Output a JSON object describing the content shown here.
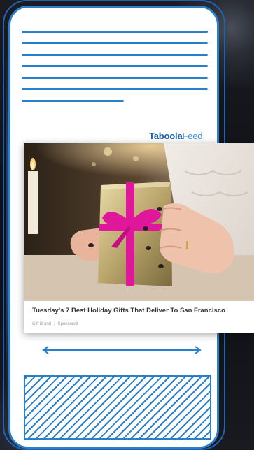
{
  "feed": {
    "logo_brand": "Taboola",
    "logo_feed": "Feed"
  },
  "card": {
    "headline": "Tuesday's 7 Best Holiday Gifts That Deliver To San Francisco",
    "source": "Gift Brand",
    "sponsored": "Sponsored"
  },
  "colors": {
    "accent": "#2a7fc9",
    "brand": "#1f5fae",
    "ribbon": "#e0169b"
  }
}
